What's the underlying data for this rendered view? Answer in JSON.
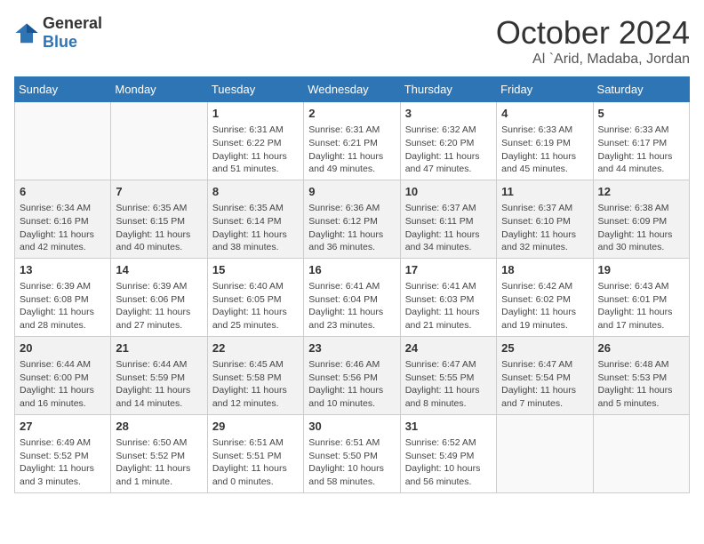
{
  "header": {
    "logo": {
      "general": "General",
      "blue": "Blue"
    },
    "title": "October 2024",
    "location": "Al `Arid, Madaba, Jordan"
  },
  "weekdays": [
    "Sunday",
    "Monday",
    "Tuesday",
    "Wednesday",
    "Thursday",
    "Friday",
    "Saturday"
  ],
  "weeks": [
    [
      {
        "day": null
      },
      {
        "day": null
      },
      {
        "day": "1",
        "sunrise": "Sunrise: 6:31 AM",
        "sunset": "Sunset: 6:22 PM",
        "daylight": "Daylight: 11 hours and 51 minutes."
      },
      {
        "day": "2",
        "sunrise": "Sunrise: 6:31 AM",
        "sunset": "Sunset: 6:21 PM",
        "daylight": "Daylight: 11 hours and 49 minutes."
      },
      {
        "day": "3",
        "sunrise": "Sunrise: 6:32 AM",
        "sunset": "Sunset: 6:20 PM",
        "daylight": "Daylight: 11 hours and 47 minutes."
      },
      {
        "day": "4",
        "sunrise": "Sunrise: 6:33 AM",
        "sunset": "Sunset: 6:19 PM",
        "daylight": "Daylight: 11 hours and 45 minutes."
      },
      {
        "day": "5",
        "sunrise": "Sunrise: 6:33 AM",
        "sunset": "Sunset: 6:17 PM",
        "daylight": "Daylight: 11 hours and 44 minutes."
      }
    ],
    [
      {
        "day": "6",
        "sunrise": "Sunrise: 6:34 AM",
        "sunset": "Sunset: 6:16 PM",
        "daylight": "Daylight: 11 hours and 42 minutes."
      },
      {
        "day": "7",
        "sunrise": "Sunrise: 6:35 AM",
        "sunset": "Sunset: 6:15 PM",
        "daylight": "Daylight: 11 hours and 40 minutes."
      },
      {
        "day": "8",
        "sunrise": "Sunrise: 6:35 AM",
        "sunset": "Sunset: 6:14 PM",
        "daylight": "Daylight: 11 hours and 38 minutes."
      },
      {
        "day": "9",
        "sunrise": "Sunrise: 6:36 AM",
        "sunset": "Sunset: 6:12 PM",
        "daylight": "Daylight: 11 hours and 36 minutes."
      },
      {
        "day": "10",
        "sunrise": "Sunrise: 6:37 AM",
        "sunset": "Sunset: 6:11 PM",
        "daylight": "Daylight: 11 hours and 34 minutes."
      },
      {
        "day": "11",
        "sunrise": "Sunrise: 6:37 AM",
        "sunset": "Sunset: 6:10 PM",
        "daylight": "Daylight: 11 hours and 32 minutes."
      },
      {
        "day": "12",
        "sunrise": "Sunrise: 6:38 AM",
        "sunset": "Sunset: 6:09 PM",
        "daylight": "Daylight: 11 hours and 30 minutes."
      }
    ],
    [
      {
        "day": "13",
        "sunrise": "Sunrise: 6:39 AM",
        "sunset": "Sunset: 6:08 PM",
        "daylight": "Daylight: 11 hours and 28 minutes."
      },
      {
        "day": "14",
        "sunrise": "Sunrise: 6:39 AM",
        "sunset": "Sunset: 6:06 PM",
        "daylight": "Daylight: 11 hours and 27 minutes."
      },
      {
        "day": "15",
        "sunrise": "Sunrise: 6:40 AM",
        "sunset": "Sunset: 6:05 PM",
        "daylight": "Daylight: 11 hours and 25 minutes."
      },
      {
        "day": "16",
        "sunrise": "Sunrise: 6:41 AM",
        "sunset": "Sunset: 6:04 PM",
        "daylight": "Daylight: 11 hours and 23 minutes."
      },
      {
        "day": "17",
        "sunrise": "Sunrise: 6:41 AM",
        "sunset": "Sunset: 6:03 PM",
        "daylight": "Daylight: 11 hours and 21 minutes."
      },
      {
        "day": "18",
        "sunrise": "Sunrise: 6:42 AM",
        "sunset": "Sunset: 6:02 PM",
        "daylight": "Daylight: 11 hours and 19 minutes."
      },
      {
        "day": "19",
        "sunrise": "Sunrise: 6:43 AM",
        "sunset": "Sunset: 6:01 PM",
        "daylight": "Daylight: 11 hours and 17 minutes."
      }
    ],
    [
      {
        "day": "20",
        "sunrise": "Sunrise: 6:44 AM",
        "sunset": "Sunset: 6:00 PM",
        "daylight": "Daylight: 11 hours and 16 minutes."
      },
      {
        "day": "21",
        "sunrise": "Sunrise: 6:44 AM",
        "sunset": "Sunset: 5:59 PM",
        "daylight": "Daylight: 11 hours and 14 minutes."
      },
      {
        "day": "22",
        "sunrise": "Sunrise: 6:45 AM",
        "sunset": "Sunset: 5:58 PM",
        "daylight": "Daylight: 11 hours and 12 minutes."
      },
      {
        "day": "23",
        "sunrise": "Sunrise: 6:46 AM",
        "sunset": "Sunset: 5:56 PM",
        "daylight": "Daylight: 11 hours and 10 minutes."
      },
      {
        "day": "24",
        "sunrise": "Sunrise: 6:47 AM",
        "sunset": "Sunset: 5:55 PM",
        "daylight": "Daylight: 11 hours and 8 minutes."
      },
      {
        "day": "25",
        "sunrise": "Sunrise: 6:47 AM",
        "sunset": "Sunset: 5:54 PM",
        "daylight": "Daylight: 11 hours and 7 minutes."
      },
      {
        "day": "26",
        "sunrise": "Sunrise: 6:48 AM",
        "sunset": "Sunset: 5:53 PM",
        "daylight": "Daylight: 11 hours and 5 minutes."
      }
    ],
    [
      {
        "day": "27",
        "sunrise": "Sunrise: 6:49 AM",
        "sunset": "Sunset: 5:52 PM",
        "daylight": "Daylight: 11 hours and 3 minutes."
      },
      {
        "day": "28",
        "sunrise": "Sunrise: 6:50 AM",
        "sunset": "Sunset: 5:52 PM",
        "daylight": "Daylight: 11 hours and 1 minute."
      },
      {
        "day": "29",
        "sunrise": "Sunrise: 6:51 AM",
        "sunset": "Sunset: 5:51 PM",
        "daylight": "Daylight: 11 hours and 0 minutes."
      },
      {
        "day": "30",
        "sunrise": "Sunrise: 6:51 AM",
        "sunset": "Sunset: 5:50 PM",
        "daylight": "Daylight: 10 hours and 58 minutes."
      },
      {
        "day": "31",
        "sunrise": "Sunrise: 6:52 AM",
        "sunset": "Sunset: 5:49 PM",
        "daylight": "Daylight: 10 hours and 56 minutes."
      },
      {
        "day": null
      },
      {
        "day": null
      }
    ]
  ]
}
